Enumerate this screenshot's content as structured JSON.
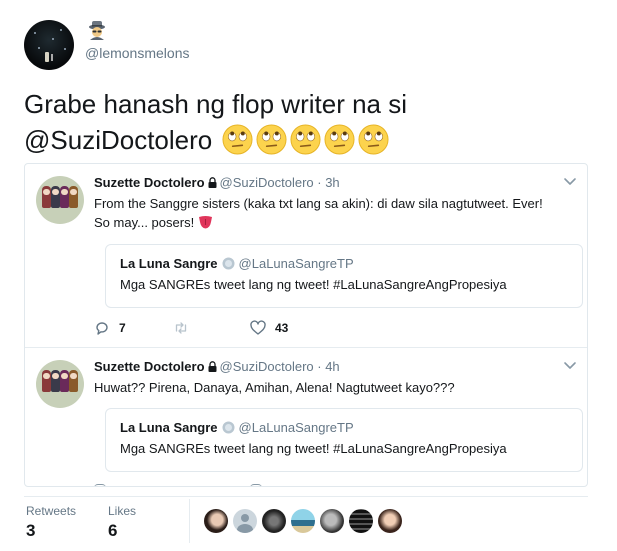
{
  "main": {
    "handle": "@lemonsmelons",
    "text": "Grabe hanash ng flop writer na si",
    "mention": "@SuziDoctolero"
  },
  "thread": [
    {
      "name": "Suzette Doctolero",
      "handle": "@SuziDoctolero",
      "time": "3h",
      "text_1": "From the Sanggre sisters (kaka txt lang sa akin): di daw sila nagtutweet.  Ever!",
      "text_2": "So may... posers!",
      "quote": {
        "name": "La Luna Sangre",
        "handle": "@LaLunaSangreTP",
        "text": "Mga SANGREs tweet lang ng tweet! #LaLunaSangreAngPropesiya"
      },
      "replies": "7",
      "likes": "43"
    },
    {
      "name": "Suzette Doctolero",
      "handle": "@SuziDoctolero",
      "time": "4h",
      "text_1": "Huwat?? Pirena, Danaya, Amihan, Alena!  Nagtutweet kayo???",
      "quote": {
        "name": "La Luna Sangre",
        "handle": "@LaLunaSangreTP",
        "text": "Mga SANGREs tweet lang ng tweet! #LaLunaSangreAngPropesiya"
      }
    }
  ],
  "stats": {
    "retweets_label": "Retweets",
    "retweets": "3",
    "likes_label": "Likes",
    "likes": "6"
  },
  "colors": {
    "text": "#14171a",
    "muted": "#657786",
    "border": "#e1e8ed"
  }
}
